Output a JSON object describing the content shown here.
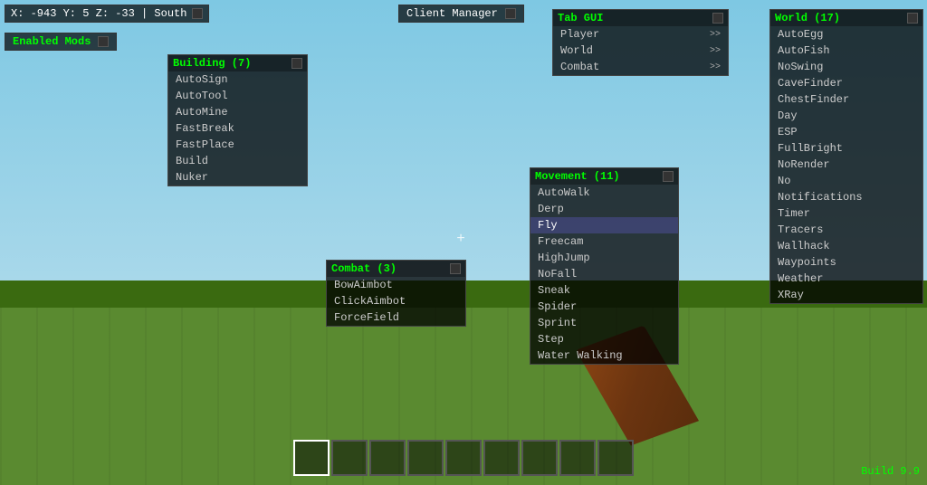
{
  "coords": {
    "text": "X: -943 Y: 5 Z: -33 | South",
    "label": "X: -943 Y: 5 Z: -33 | South"
  },
  "client_manager": {
    "label": "Client Manager"
  },
  "enabled_mods": {
    "label": "Enabled Mods"
  },
  "build": {
    "label": "Build 9.9"
  },
  "crosshair": {
    "symbol": "+"
  },
  "building_window": {
    "title": "Building (7)",
    "items": [
      "AutoSign",
      "AutoTool",
      "AutoMine",
      "FastBreak",
      "FastPlace",
      "Build",
      "Nuker"
    ]
  },
  "tab_gui_window": {
    "title": "Tab GUI",
    "items": [
      {
        "label": "Player",
        "arrow": ">>"
      },
      {
        "label": "World",
        "arrow": ">>"
      },
      {
        "label": "Combat",
        "arrow": ">>"
      }
    ]
  },
  "world_window": {
    "title": "World (17)",
    "items": [
      "AutoEgg",
      "AutoFish",
      "NoSwing",
      "CaveFinder",
      "ChestFinder",
      "Day",
      "ESP",
      "FullBright",
      "NoRender",
      "No",
      "Notifications",
      "Timer",
      "Tracers",
      "Wallhack",
      "Waypoints",
      "Weather",
      "XRay"
    ]
  },
  "movement_window": {
    "title": "Movement (11)",
    "items": [
      {
        "label": "AutoWalk",
        "selected": false
      },
      {
        "label": "Derp",
        "selected": false
      },
      {
        "label": "Fly",
        "selected": true
      },
      {
        "label": "Freecam",
        "selected": false
      },
      {
        "label": "HighJump",
        "selected": false
      },
      {
        "label": "NoFall",
        "selected": false
      },
      {
        "label": "Sneak",
        "selected": false
      },
      {
        "label": "Spider",
        "selected": false
      },
      {
        "label": "Sprint",
        "selected": false
      },
      {
        "label": "Step",
        "selected": false
      },
      {
        "label": "Water Walking",
        "selected": false
      }
    ]
  },
  "combat_window": {
    "title": "Combat (3)",
    "items": [
      "BowAimbot",
      "ClickAimbot",
      "ForceField"
    ]
  },
  "hotbar": {
    "slots": [
      0,
      1,
      2,
      3,
      4,
      5,
      6,
      7,
      8
    ],
    "active_slot": 0
  }
}
